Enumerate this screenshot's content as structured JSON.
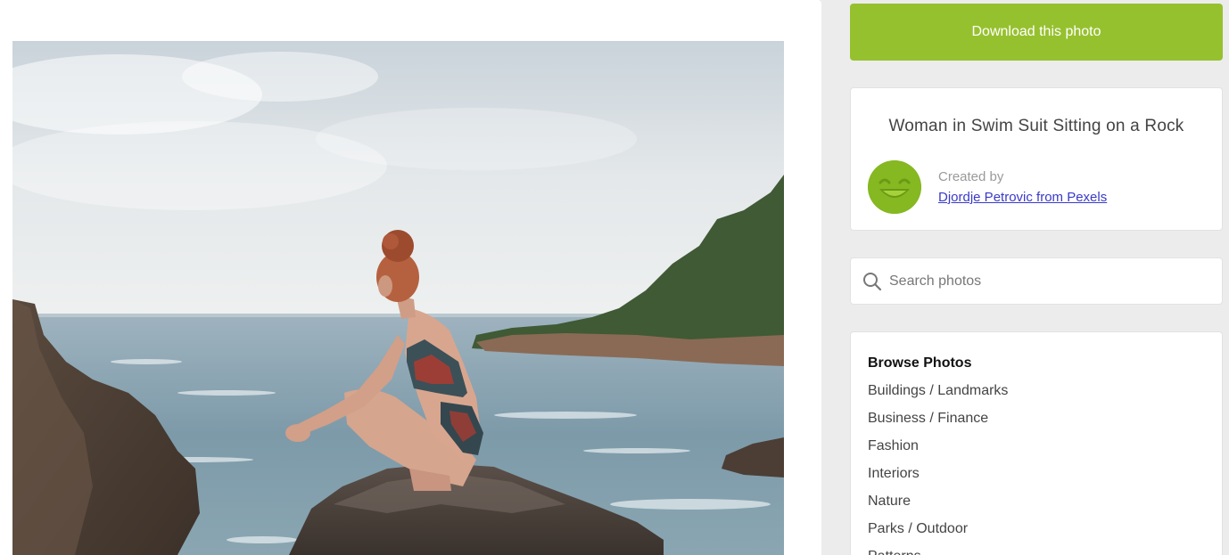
{
  "photo": {
    "alt": "Woman in Swim Suit Sitting on a Rock"
  },
  "sidebar": {
    "download_label": "Download this photo",
    "photo_title": "Woman in Swim Suit Sitting on a Rock",
    "created_by_label": "Created by",
    "author": "Djordje Petrovic from Pexels",
    "search_placeholder": "Search photos",
    "browse_title": "Browse Photos",
    "browse_items": [
      "Buildings / Landmarks",
      "Business / Finance",
      "Fashion",
      "Interiors",
      "Nature",
      "Parks / Outdoor",
      "Patterns"
    ]
  },
  "colors": {
    "accent_green": "#96c12f",
    "avatar_green": "#85b821",
    "link_blue": "#3a3ac8",
    "page_bg": "#ececec"
  },
  "icons": [
    "search-icon",
    "smiley-avatar-icon"
  ]
}
